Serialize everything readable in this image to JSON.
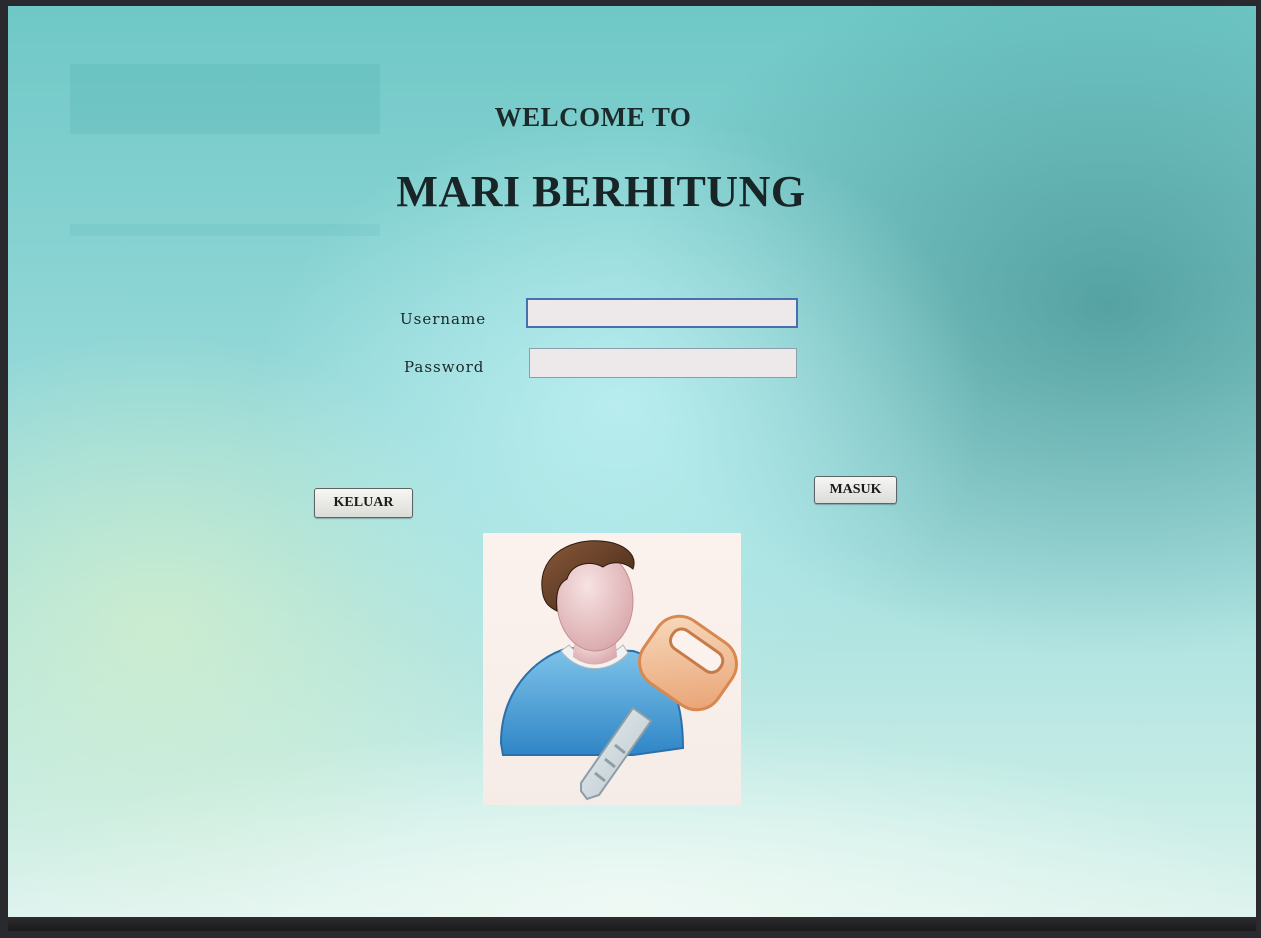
{
  "header": {
    "welcome_text": "WELCOME TO",
    "app_title": "MARI BERHITUNG"
  },
  "login_form": {
    "username_label": "Username",
    "username_value": "",
    "password_label": "Password",
    "password_value": ""
  },
  "buttons": {
    "exit_label": "KELUAR",
    "login_label": "MASUK"
  },
  "image": {
    "icon": "user-with-key-icon"
  },
  "colors": {
    "background": "#8fd6d6",
    "title_text": "#182426",
    "field_border_focused": "#4a6fb0"
  }
}
